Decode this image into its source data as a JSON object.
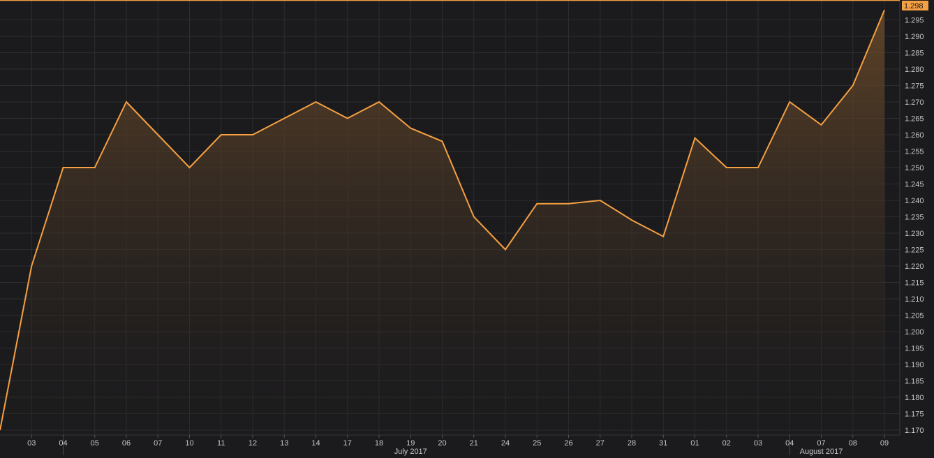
{
  "chart_data": {
    "type": "area",
    "title": "",
    "xlabel": "",
    "ylabel": "",
    "ylim": [
      1.168,
      1.3
    ],
    "y_ticks": [
      "1.170",
      "1.175",
      "1.180",
      "1.185",
      "1.190",
      "1.195",
      "1.200",
      "1.205",
      "1.210",
      "1.215",
      "1.220",
      "1.225",
      "1.230",
      "1.235",
      "1.240",
      "1.245",
      "1.250",
      "1.255",
      "1.260",
      "1.265",
      "1.270",
      "1.275",
      "1.280",
      "1.285",
      "1.290",
      "1.295"
    ],
    "categories": [
      "",
      "03",
      "04",
      "05",
      "06",
      "07",
      "10",
      "11",
      "12",
      "13",
      "14",
      "17",
      "18",
      "19",
      "20",
      "21",
      "24",
      "25",
      "26",
      "27",
      "28",
      "31",
      "01",
      "02",
      "03",
      "04",
      "07",
      "08",
      "09"
    ],
    "values": [
      1.17,
      1.22,
      1.25,
      1.25,
      1.27,
      1.26,
      1.25,
      1.26,
      1.26,
      1.265,
      1.27,
      1.265,
      1.27,
      1.262,
      1.258,
      1.235,
      1.225,
      1.239,
      1.239,
      1.24,
      1.234,
      1.229,
      1.259,
      1.25,
      1.25,
      1.27,
      1.263,
      1.275,
      1.298
    ],
    "month_labels": [
      {
        "label": "July 2017",
        "index": 13
      },
      {
        "label": "August 2017",
        "index": 26
      }
    ],
    "month_dividers": [
      2,
      25
    ],
    "last_value_label": "1.298",
    "grid": true,
    "colors": {
      "background": "#1b1b1d",
      "grid": "#2e2e31",
      "line": "#f5a042",
      "fill_top": "#6b4a2a",
      "axis_text": "#c8c8c8"
    }
  }
}
